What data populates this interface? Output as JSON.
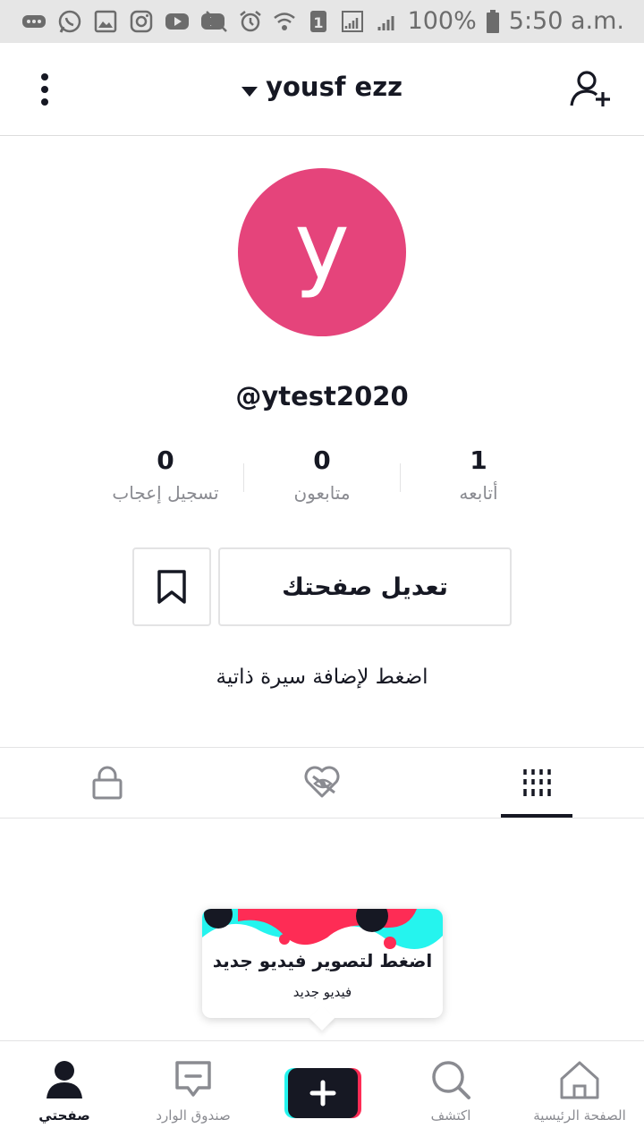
{
  "status_bar": {
    "battery": "100%",
    "time": "5:50 a.m.",
    "sim": "1"
  },
  "header": {
    "username": "yousf ezz",
    "icons": [
      "menu-dots-icon",
      "chevron-down-icon",
      "add-user-icon"
    ]
  },
  "profile": {
    "avatar_letter": "y",
    "handle": "@ytest2020",
    "avatar_color": "#e5447b"
  },
  "stats": {
    "following": {
      "value": "1",
      "label": "أتابعه"
    },
    "followers": {
      "value": "0",
      "label": "متابعون"
    },
    "likes": {
      "value": "0",
      "label": "تسجيل إعجاب"
    }
  },
  "actions": {
    "edit_label": "تعديل صفحتك",
    "bio_prompt": "اضغط لإضافة سيرة ذاتية"
  },
  "tabs": {
    "items": [
      "videos-grid-icon",
      "liked-hidden-icon",
      "private-lock-icon"
    ],
    "selected": "videos-grid-icon"
  },
  "tooltip": {
    "title": "اضغط لتصوير فيديو جديد",
    "subtitle": "فيديو جديد"
  },
  "bottom_nav": {
    "home": "الصفحة الرئيسية",
    "discover": "اكتشف",
    "inbox": "صندوق الوارد",
    "me": "صفحتي"
  },
  "colors": {
    "accent_pink": "#fe2c55",
    "accent_cyan": "#25f4ee",
    "text_dark": "#161823",
    "text_gray": "#8a8b91"
  }
}
